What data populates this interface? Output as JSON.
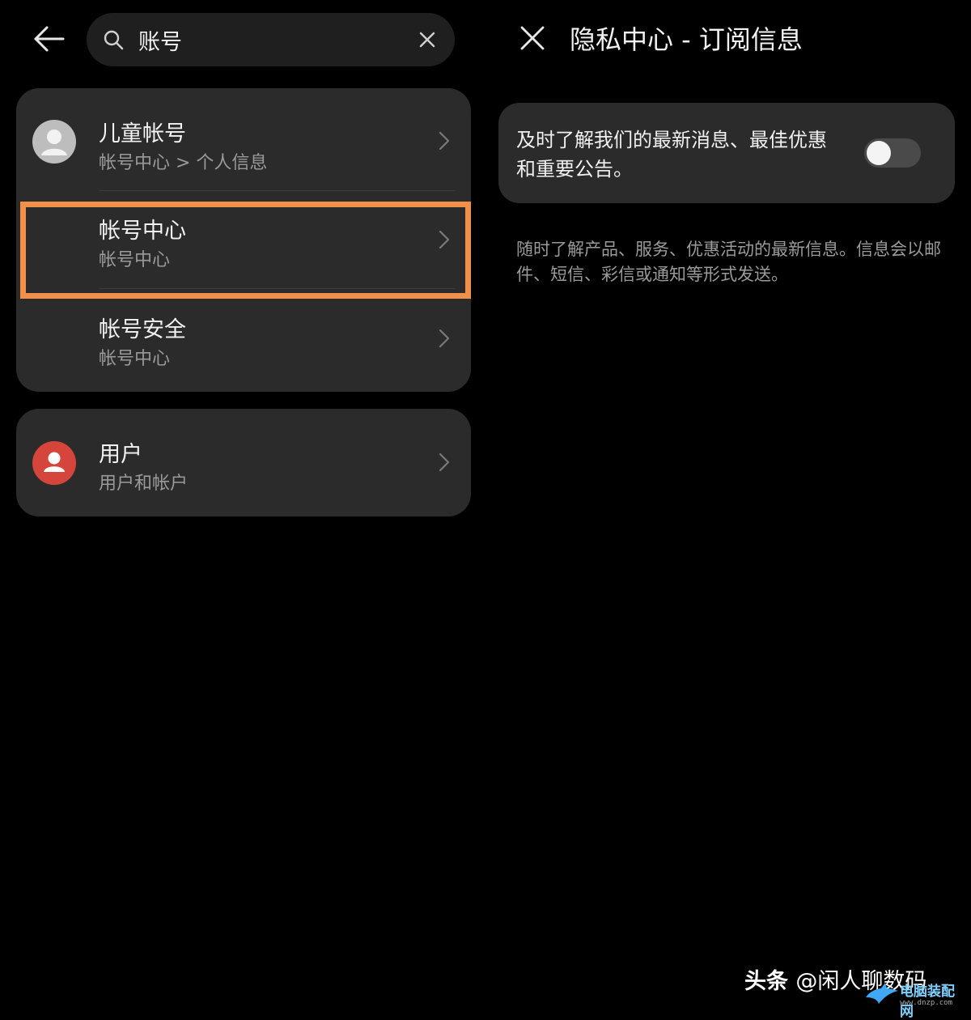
{
  "search": {
    "query": "账号"
  },
  "results": {
    "group1": [
      {
        "title": "儿童帐号",
        "path": "帐号中心 > 个人信息",
        "avatar": "person-gray"
      },
      {
        "title": "帐号中心",
        "path": "帐号中心",
        "highlighted": true
      },
      {
        "title": "帐号安全",
        "path": "帐号中心"
      }
    ],
    "group2": [
      {
        "title": "用户",
        "path": "用户和帐户",
        "avatar": "person-red"
      }
    ]
  },
  "detail": {
    "title": "隐私中心 - 订阅信息",
    "toggle_label": "及时了解我们的最新消息、最佳优惠和重要公告。",
    "toggle_on": false,
    "description": "随时了解产品、服务、优惠活动的最新信息。信息会以邮件、短信、彩信或通知等形式发送。"
  },
  "watermark": {
    "brand": "头条",
    "handle": "@闲人聊数码",
    "site_name": "电脑装配网",
    "site_url": "www.dnzp.com"
  },
  "colors": {
    "background": "#000000",
    "card": "#2b2b2b",
    "highlight_border": "#f0904a",
    "avatar_red": "#d6453c",
    "avatar_gray": "#bdbdbd"
  }
}
